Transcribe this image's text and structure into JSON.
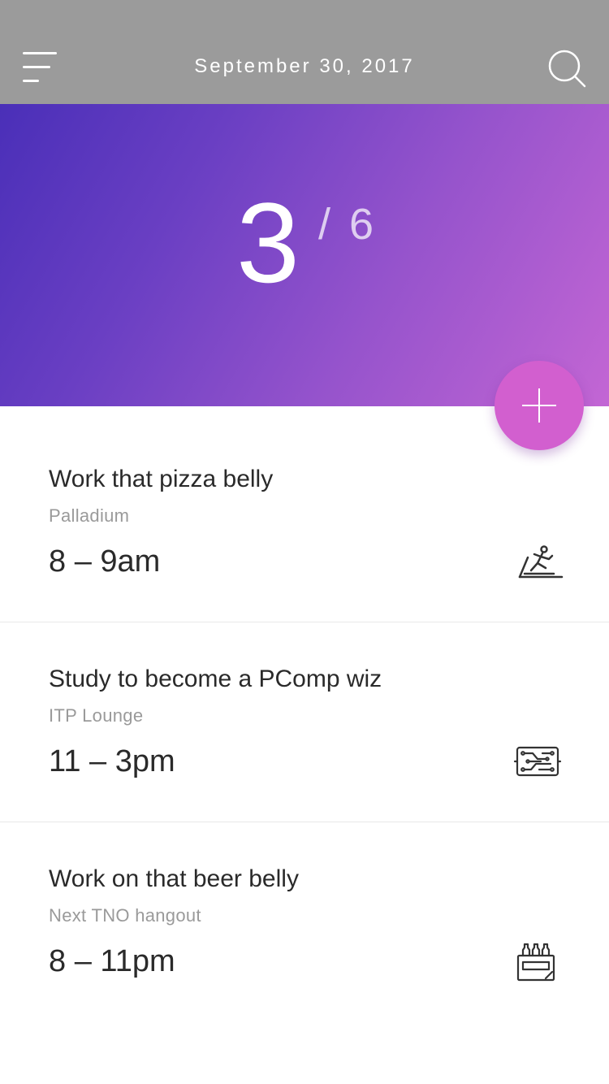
{
  "header": {
    "date": "September 30, 2017",
    "menu_icon": "menu-icon",
    "search_icon": "search-icon"
  },
  "progress": {
    "completed": "3",
    "total": "/ 6"
  },
  "add_button_icon": "plus-icon",
  "events": [
    {
      "title": "Work that pizza belly",
      "location": "Palladium",
      "time": "8 – 9am",
      "icon": "treadmill-icon"
    },
    {
      "title": "Study to become a PComp wiz",
      "location": "ITP Lounge",
      "time": "11 – 3pm",
      "icon": "circuit-board-icon"
    },
    {
      "title": "Work on that beer belly",
      "location": "Next TNO hangout",
      "time": "8 – 11pm",
      "icon": "beer-pack-icon"
    }
  ],
  "colors": {
    "header_bg": "#9b9b9b",
    "gradient_start": "#4a2fb8",
    "gradient_end": "#c366d4",
    "fab": "#d25fcf",
    "text_primary": "#2a2a2a",
    "text_secondary": "#9a9a9a"
  }
}
